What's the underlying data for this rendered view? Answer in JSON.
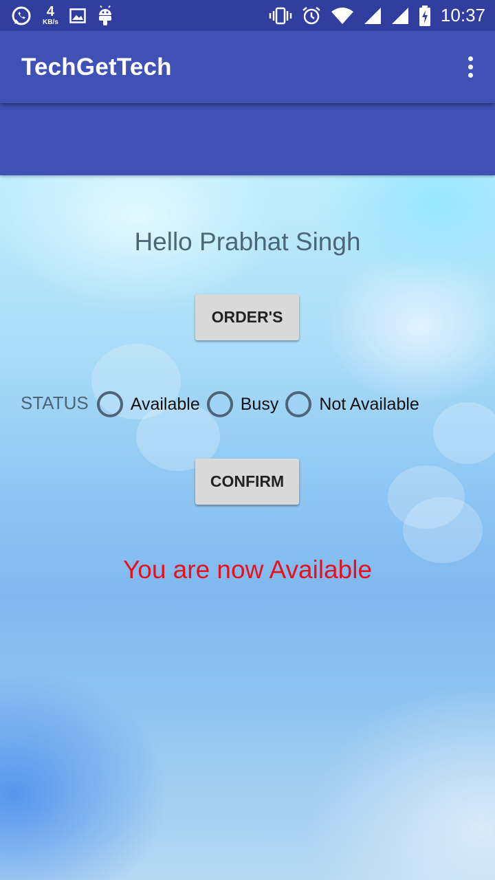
{
  "status_bar": {
    "speed_value": "4",
    "speed_unit": "KB/s",
    "time": "10:37",
    "icons": [
      "whatsapp-icon",
      "image-icon",
      "android-icon",
      "vibrate-icon",
      "alarm-icon",
      "wifi-icon",
      "signal-icon",
      "signal-icon",
      "battery-charging-icon"
    ]
  },
  "app_bar": {
    "title": "TechGetTech",
    "menu_icon": "overflow-menu-icon"
  },
  "main": {
    "greeting": "Hello Prabhat Singh",
    "orders_button": "ORDER'S",
    "status_label": "STATUS",
    "status_options": [
      {
        "label": "Available",
        "selected": false
      },
      {
        "label": "Busy",
        "selected": false
      },
      {
        "label": "Not Available",
        "selected": false
      }
    ],
    "confirm_button": "CONFIRM",
    "message": "You are now Available"
  },
  "colors": {
    "primary": "#3f51b5",
    "primary_dark": "#303f9f",
    "message": "#e8101c"
  }
}
